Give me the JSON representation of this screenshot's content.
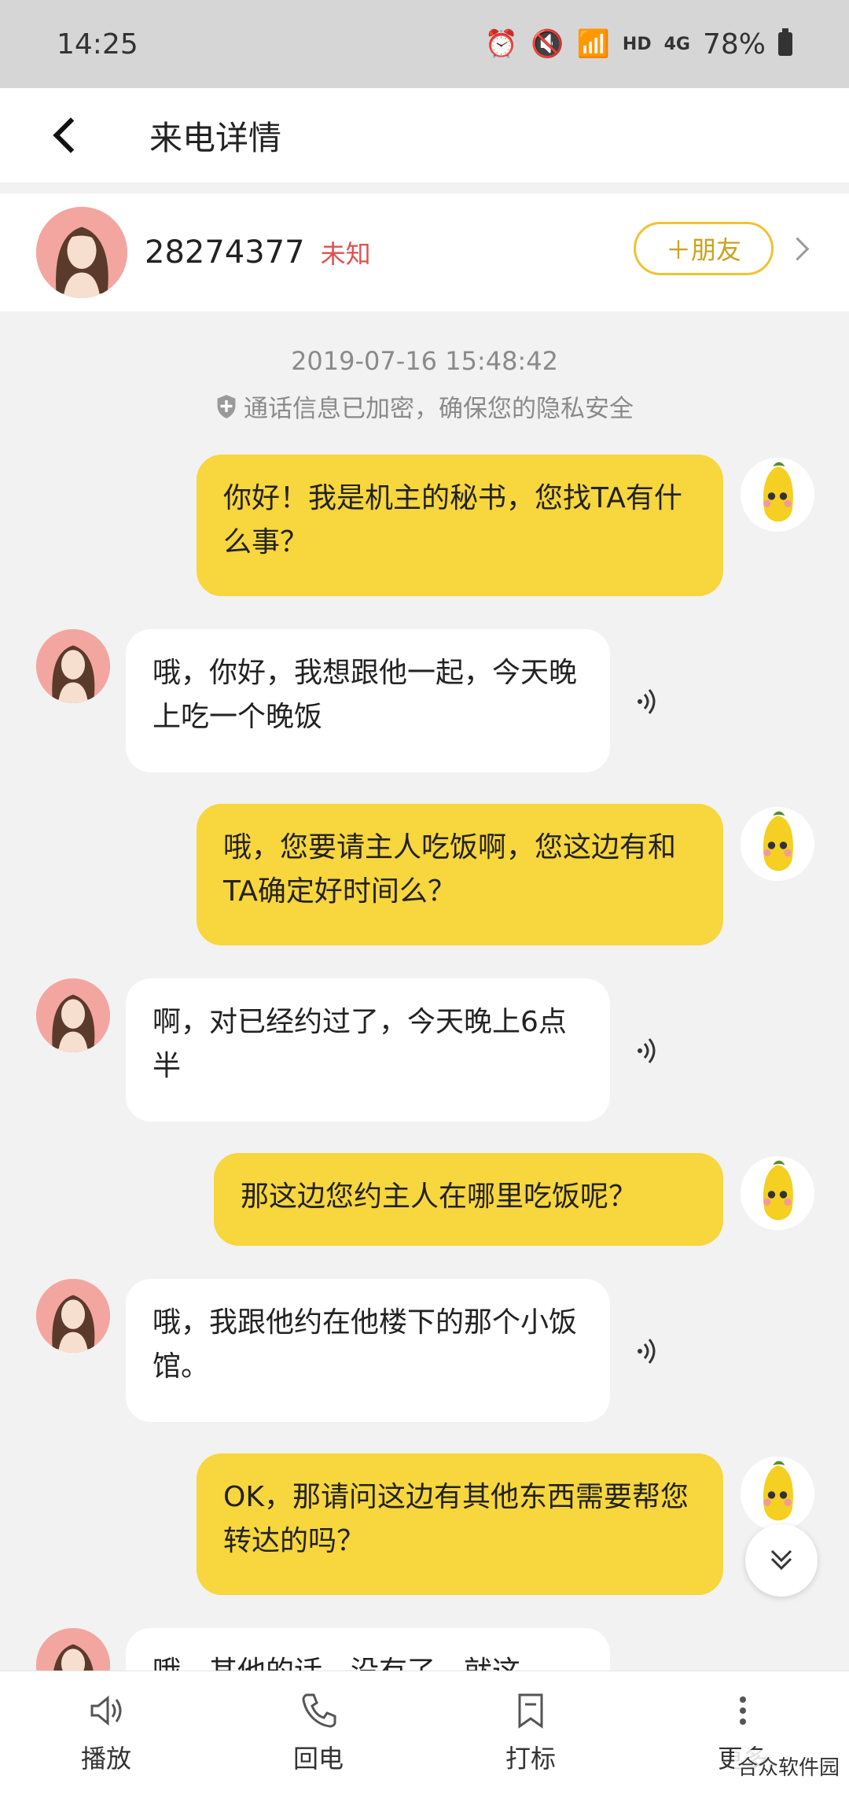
{
  "status_bar": {
    "time": "14:25",
    "network": "HD",
    "signal": "4G",
    "battery": "78%"
  },
  "header": {
    "title": "来电详情"
  },
  "contact": {
    "number": "28274377",
    "tag": "未知",
    "add_friend_label": "＋朋友"
  },
  "call": {
    "timestamp": "2019-07-16 15:48:42",
    "privacy_note": "通话信息已加密，确保您的隐私安全"
  },
  "messages": [
    {
      "from": "assistant",
      "text": "你好！我是机主的秘书，您找TA有什么事？"
    },
    {
      "from": "caller",
      "text": "哦，你好，我想跟他一起，今天晚上吃一个晚饭"
    },
    {
      "from": "assistant",
      "text": "哦，您要请主人吃饭啊，您这边有和TA确定好时间么？"
    },
    {
      "from": "caller",
      "text": "啊，对已经约过了，今天晚上6点半"
    },
    {
      "from": "assistant",
      "text": "那这边您约主人在哪里吃饭呢？"
    },
    {
      "from": "caller",
      "text": "哦，我跟他约在他楼下的那个小饭馆。"
    },
    {
      "from": "assistant",
      "text": "OK，那请问这边有其他东西需要帮您转达的吗？"
    },
    {
      "from": "caller",
      "text": "哦，其他的话，没有了，就这"
    }
  ],
  "bottom_bar": {
    "play": "播放",
    "callback": "回电",
    "mark": "打标",
    "more": "更多"
  },
  "watermark": "合众软件园",
  "colors": {
    "accent": "#f7d63e",
    "tag_red": "#e05050"
  }
}
